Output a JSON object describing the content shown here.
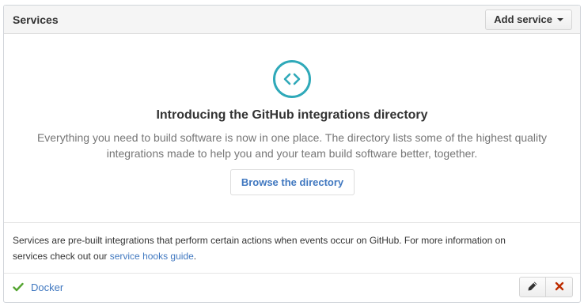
{
  "header": {
    "title": "Services",
    "add_button_label": "Add service"
  },
  "intro": {
    "icon": "code-icon",
    "title": "Introducing the GitHub integrations directory",
    "text_line1": "Everything you need to build software is now in one place. The directory lists some of the highest quality",
    "text_line2": "integrations made to help you and your team build software better, together.",
    "browse_button_label": "Browse the directory"
  },
  "description": {
    "text_line1": "Services are pre-built integrations that perform certain actions when events occur on GitHub. For more information on",
    "text_line2_prefix": "services check out our ",
    "link_label": "service hooks guide",
    "text_line2_suffix": "."
  },
  "services": [
    {
      "name": "Docker",
      "status": "active",
      "status_icon": "check-icon"
    }
  ],
  "colors": {
    "accent_teal": "#2fa9b9",
    "link_blue": "#4078c0",
    "check_green": "#55a532",
    "delete_red": "#bd2c00"
  }
}
